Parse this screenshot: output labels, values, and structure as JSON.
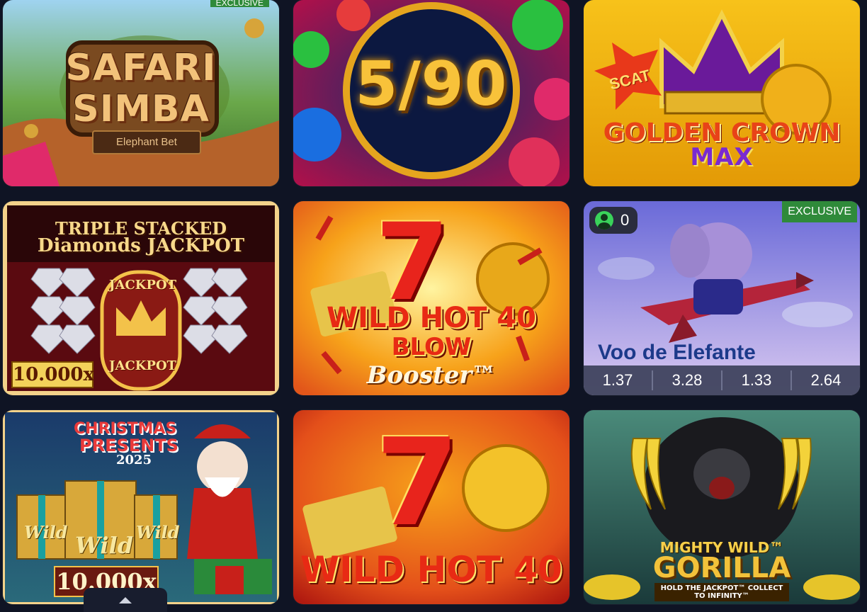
{
  "games": [
    {
      "name": "Safari Simba",
      "title_line1": "SAFARI",
      "title_line2": "SIMBA",
      "brand": "Elephant Bet",
      "badge": "EXCLUSIVE"
    },
    {
      "name": "5/90",
      "title": "5/90"
    },
    {
      "name": "Golden Crown Max",
      "scat": "SCAT",
      "title_line1": "GOLDEN CROWN",
      "title_line2": "MAX"
    },
    {
      "name": "Triple Stacked Diamonds Jackpot",
      "title_line1": "TRIPLE STACKED",
      "title_line2": "Diamonds JACKPOT",
      "jackpot_top": "JACKPOT",
      "jackpot_bottom": "JACKPOT",
      "multiplier": "10.000x"
    },
    {
      "name": "Wild Hot 40 Blow Booster",
      "seven": "7",
      "title_line1": "WILD HOT 40",
      "title_line2": "BLOW",
      "title_line3": "Booster™"
    },
    {
      "name": "Voo do Elefante",
      "badge": "EXCLUSIVE",
      "players": "0",
      "logo_text": "Voo de Elefante",
      "multipliers": [
        "1.37",
        "3.28",
        "1.33",
        "2.64"
      ]
    },
    {
      "name": "Christmas Presents 2025",
      "title_line1": "CHRISTMAS",
      "title_line2": "PRESENTS",
      "title_line3": "2025",
      "wild": "Wild",
      "multiplier": "10.000x"
    },
    {
      "name": "Wild Hot 40",
      "seven": "7",
      "title": "WILD HOT 40"
    },
    {
      "name": "Mighty Wild Gorilla",
      "title_line1": "MIGHTY WILD™",
      "title_line2": "GORILLA",
      "tagline": "HOLD THE JACKPOT™ COLLECT TO INFINITY™"
    }
  ],
  "colors": {
    "background": "#0f1424",
    "exclusive_badge": "#2f8a3a",
    "online_indicator": "#3ad35a"
  },
  "icons": {
    "players": "user-icon",
    "scroll": "chevron-up-icon"
  }
}
